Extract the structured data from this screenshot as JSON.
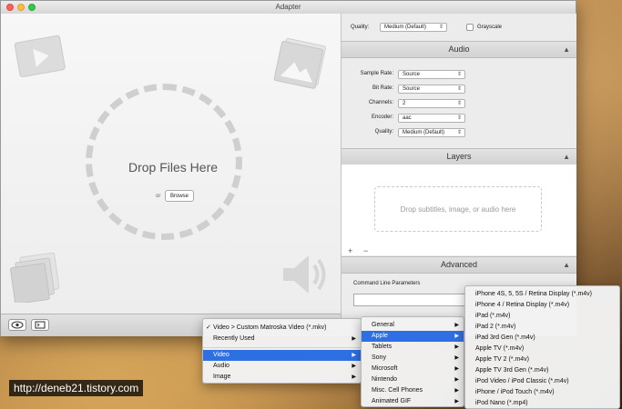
{
  "watermark": "http://deneb21.tistory.com",
  "window": {
    "title": "Adapter"
  },
  "drop_zone": {
    "title": "Drop Files Here",
    "or_text": "or",
    "browse_label": "Browse"
  },
  "quality_bar": {
    "label": "Quality:",
    "value": "Medium (Default)",
    "grayscale_label": "Grayscale"
  },
  "audio": {
    "header": "Audio",
    "fields": [
      {
        "label": "Sample Rate:",
        "value": "Source"
      },
      {
        "label": "Bit Rate:",
        "value": "Source"
      },
      {
        "label": "Channels:",
        "value": "2"
      },
      {
        "label": "Encoder:",
        "value": "aac"
      },
      {
        "label": "Quality:",
        "value": "Medium (Default)"
      }
    ]
  },
  "layers": {
    "header": "Layers",
    "drop_text": "Drop subtitles, image, or audio here",
    "add": "+",
    "remove": "−"
  },
  "advanced": {
    "header": "Advanced",
    "cmd_label": "Command Line Parameters"
  },
  "menu1": {
    "items": [
      {
        "label": "Video > Custom Matroska Video (*.mkv)",
        "checked": true
      },
      {
        "label": "Recently Used",
        "submenu": true
      },
      {
        "label": "Video",
        "submenu": true,
        "selected": true
      },
      {
        "label": "Audio",
        "submenu": true
      },
      {
        "label": "Image",
        "submenu": true
      }
    ]
  },
  "menu2": {
    "items": [
      {
        "label": "General",
        "submenu": true
      },
      {
        "label": "Apple",
        "submenu": true,
        "selected": true
      },
      {
        "label": "Tablets",
        "submenu": true
      },
      {
        "label": "Sony",
        "submenu": true
      },
      {
        "label": "Microsoft",
        "submenu": true
      },
      {
        "label": "Nintendo",
        "submenu": true
      },
      {
        "label": "Misc. Cell Phones",
        "submenu": true
      },
      {
        "label": "Animated GIF",
        "submenu": true
      }
    ]
  },
  "menu3": {
    "items": [
      "iPhone 4S, 5, 5S / Retina Display (*.m4v)",
      "iPhone 4 / Retina Display (*.m4v)",
      "iPad (*.m4v)",
      "iPad 2 (*.m4v)",
      "iPad 3rd Gen (*.m4v)",
      "Apple TV (*.m4v)",
      "Apple TV 2 (*.m4v)",
      "Apple TV 3rd Gen (*.m4v)",
      "iPod Video / iPod Classic (*.m4v)",
      "iPhone / iPod Touch (*.m4v)",
      "iPod Nano (*.mp4)"
    ]
  }
}
